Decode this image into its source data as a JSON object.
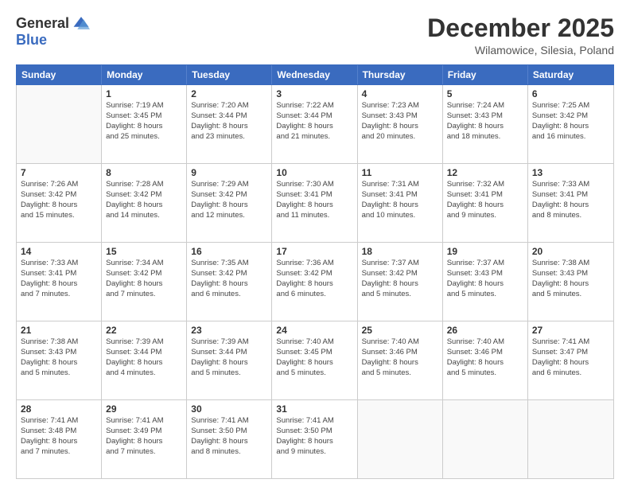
{
  "logo": {
    "general": "General",
    "blue": "Blue"
  },
  "title": "December 2025",
  "location": "Wilamowice, Silesia, Poland",
  "days_header": [
    "Sunday",
    "Monday",
    "Tuesday",
    "Wednesday",
    "Thursday",
    "Friday",
    "Saturday"
  ],
  "weeks": [
    [
      {
        "day": "",
        "text": ""
      },
      {
        "day": "1",
        "text": "Sunrise: 7:19 AM\nSunset: 3:45 PM\nDaylight: 8 hours\nand 25 minutes."
      },
      {
        "day": "2",
        "text": "Sunrise: 7:20 AM\nSunset: 3:44 PM\nDaylight: 8 hours\nand 23 minutes."
      },
      {
        "day": "3",
        "text": "Sunrise: 7:22 AM\nSunset: 3:44 PM\nDaylight: 8 hours\nand 21 minutes."
      },
      {
        "day": "4",
        "text": "Sunrise: 7:23 AM\nSunset: 3:43 PM\nDaylight: 8 hours\nand 20 minutes."
      },
      {
        "day": "5",
        "text": "Sunrise: 7:24 AM\nSunset: 3:43 PM\nDaylight: 8 hours\nand 18 minutes."
      },
      {
        "day": "6",
        "text": "Sunrise: 7:25 AM\nSunset: 3:42 PM\nDaylight: 8 hours\nand 16 minutes."
      }
    ],
    [
      {
        "day": "7",
        "text": "Sunrise: 7:26 AM\nSunset: 3:42 PM\nDaylight: 8 hours\nand 15 minutes."
      },
      {
        "day": "8",
        "text": "Sunrise: 7:28 AM\nSunset: 3:42 PM\nDaylight: 8 hours\nand 14 minutes."
      },
      {
        "day": "9",
        "text": "Sunrise: 7:29 AM\nSunset: 3:42 PM\nDaylight: 8 hours\nand 12 minutes."
      },
      {
        "day": "10",
        "text": "Sunrise: 7:30 AM\nSunset: 3:41 PM\nDaylight: 8 hours\nand 11 minutes."
      },
      {
        "day": "11",
        "text": "Sunrise: 7:31 AM\nSunset: 3:41 PM\nDaylight: 8 hours\nand 10 minutes."
      },
      {
        "day": "12",
        "text": "Sunrise: 7:32 AM\nSunset: 3:41 PM\nDaylight: 8 hours\nand 9 minutes."
      },
      {
        "day": "13",
        "text": "Sunrise: 7:33 AM\nSunset: 3:41 PM\nDaylight: 8 hours\nand 8 minutes."
      }
    ],
    [
      {
        "day": "14",
        "text": "Sunrise: 7:33 AM\nSunset: 3:41 PM\nDaylight: 8 hours\nand 7 minutes."
      },
      {
        "day": "15",
        "text": "Sunrise: 7:34 AM\nSunset: 3:42 PM\nDaylight: 8 hours\nand 7 minutes."
      },
      {
        "day": "16",
        "text": "Sunrise: 7:35 AM\nSunset: 3:42 PM\nDaylight: 8 hours\nand 6 minutes."
      },
      {
        "day": "17",
        "text": "Sunrise: 7:36 AM\nSunset: 3:42 PM\nDaylight: 8 hours\nand 6 minutes."
      },
      {
        "day": "18",
        "text": "Sunrise: 7:37 AM\nSunset: 3:42 PM\nDaylight: 8 hours\nand 5 minutes."
      },
      {
        "day": "19",
        "text": "Sunrise: 7:37 AM\nSunset: 3:43 PM\nDaylight: 8 hours\nand 5 minutes."
      },
      {
        "day": "20",
        "text": "Sunrise: 7:38 AM\nSunset: 3:43 PM\nDaylight: 8 hours\nand 5 minutes."
      }
    ],
    [
      {
        "day": "21",
        "text": "Sunrise: 7:38 AM\nSunset: 3:43 PM\nDaylight: 8 hours\nand 5 minutes."
      },
      {
        "day": "22",
        "text": "Sunrise: 7:39 AM\nSunset: 3:44 PM\nDaylight: 8 hours\nand 4 minutes."
      },
      {
        "day": "23",
        "text": "Sunrise: 7:39 AM\nSunset: 3:44 PM\nDaylight: 8 hours\nand 5 minutes."
      },
      {
        "day": "24",
        "text": "Sunrise: 7:40 AM\nSunset: 3:45 PM\nDaylight: 8 hours\nand 5 minutes."
      },
      {
        "day": "25",
        "text": "Sunrise: 7:40 AM\nSunset: 3:46 PM\nDaylight: 8 hours\nand 5 minutes."
      },
      {
        "day": "26",
        "text": "Sunrise: 7:40 AM\nSunset: 3:46 PM\nDaylight: 8 hours\nand 5 minutes."
      },
      {
        "day": "27",
        "text": "Sunrise: 7:41 AM\nSunset: 3:47 PM\nDaylight: 8 hours\nand 6 minutes."
      }
    ],
    [
      {
        "day": "28",
        "text": "Sunrise: 7:41 AM\nSunset: 3:48 PM\nDaylight: 8 hours\nand 7 minutes."
      },
      {
        "day": "29",
        "text": "Sunrise: 7:41 AM\nSunset: 3:49 PM\nDaylight: 8 hours\nand 7 minutes."
      },
      {
        "day": "30",
        "text": "Sunrise: 7:41 AM\nSunset: 3:50 PM\nDaylight: 8 hours\nand 8 minutes."
      },
      {
        "day": "31",
        "text": "Sunrise: 7:41 AM\nSunset: 3:50 PM\nDaylight: 8 hours\nand 9 minutes."
      },
      {
        "day": "",
        "text": ""
      },
      {
        "day": "",
        "text": ""
      },
      {
        "day": "",
        "text": ""
      }
    ]
  ]
}
